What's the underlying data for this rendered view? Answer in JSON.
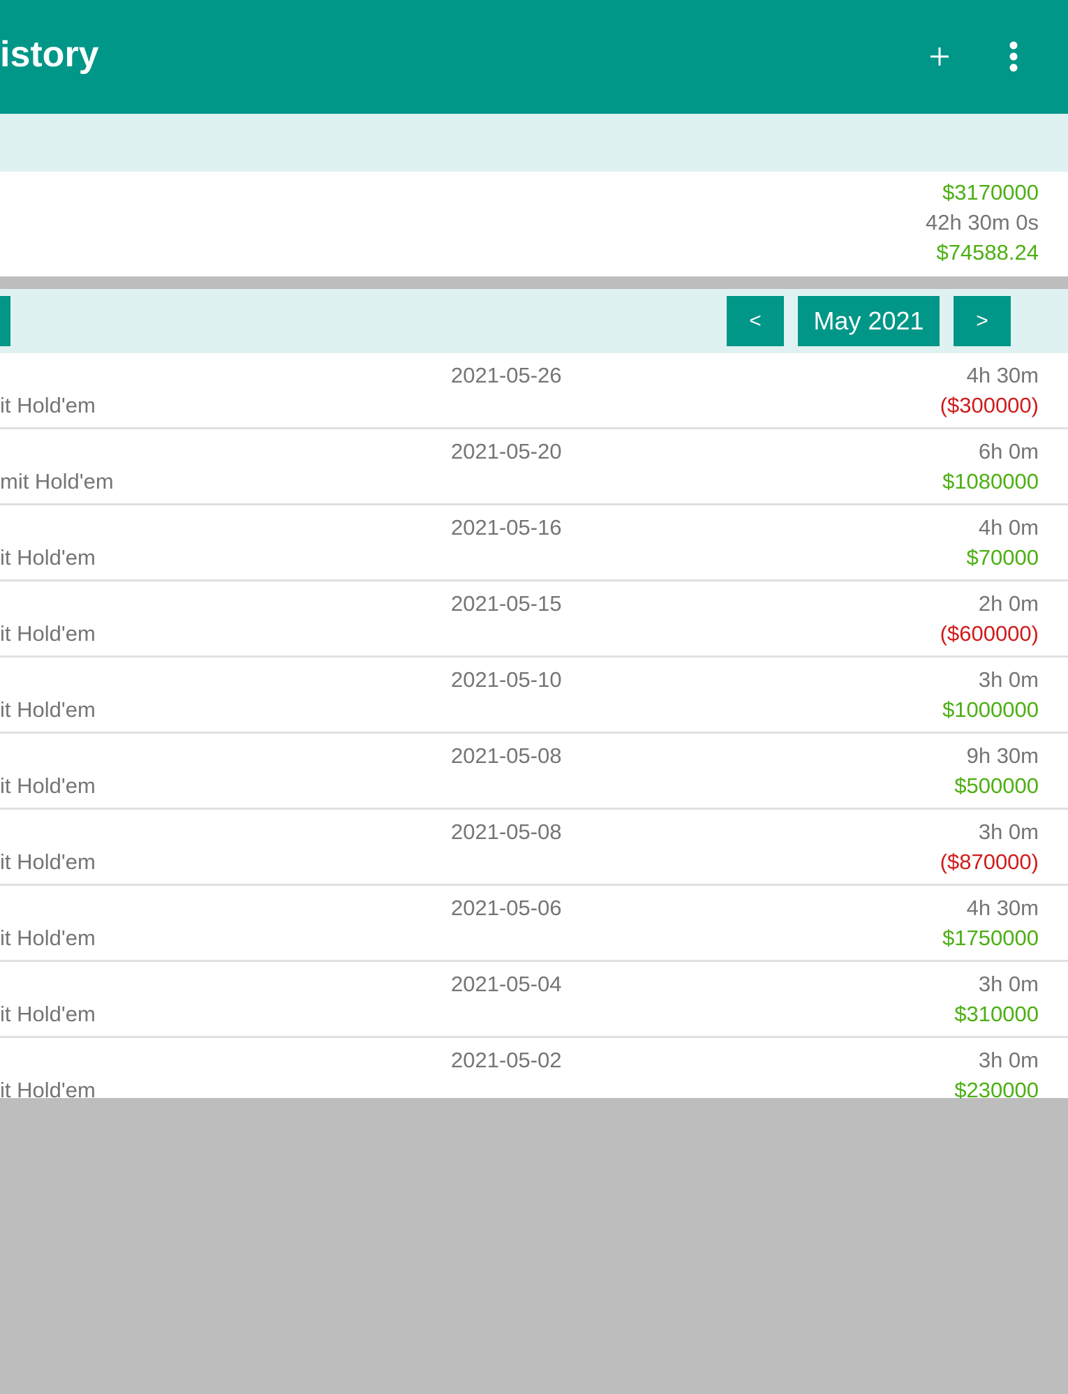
{
  "toolbar": {
    "title": "istory",
    "add_icon": "plus-icon",
    "more_icon": "more-vert-icon",
    "background": "#009688"
  },
  "summary": {
    "total_result": "$3170000",
    "total_time": "42h 30m 0s",
    "hourly_rate": "$74588.24"
  },
  "month_nav": {
    "prev_label": "<",
    "month_label": "May 2021",
    "next_label": ">"
  },
  "colors": {
    "win": "#4caf12",
    "loss": "#d01c1c",
    "accent": "#009688"
  },
  "sessions": [
    {
      "game": "it Hold'em",
      "date": "2021-05-26",
      "duration": "4h 30m",
      "result": "($300000)",
      "status": "loss"
    },
    {
      "game": "mit Hold'em",
      "date": "2021-05-20",
      "duration": "6h 0m",
      "result": "$1080000",
      "status": "win"
    },
    {
      "game": "it Hold'em",
      "date": "2021-05-16",
      "duration": "4h 0m",
      "result": "$70000",
      "status": "win"
    },
    {
      "game": "it Hold'em",
      "date": "2021-05-15",
      "duration": "2h 0m",
      "result": "($600000)",
      "status": "loss"
    },
    {
      "game": "it Hold'em",
      "date": "2021-05-10",
      "duration": "3h 0m",
      "result": "$1000000",
      "status": "win"
    },
    {
      "game": "it Hold'em",
      "date": "2021-05-08",
      "duration": "9h 30m",
      "result": "$500000",
      "status": "win"
    },
    {
      "game": "it Hold'em",
      "date": "2021-05-08",
      "duration": "3h 0m",
      "result": "($870000)",
      "status": "loss"
    },
    {
      "game": "it Hold'em",
      "date": "2021-05-06",
      "duration": "4h 30m",
      "result": "$1750000",
      "status": "win"
    },
    {
      "game": "it Hold'em",
      "date": "2021-05-04",
      "duration": "3h 0m",
      "result": "$310000",
      "status": "win"
    },
    {
      "game": "it Hold'em",
      "date": "2021-05-02",
      "duration": "3h 0m",
      "result": "$230000",
      "status": "win"
    }
  ]
}
